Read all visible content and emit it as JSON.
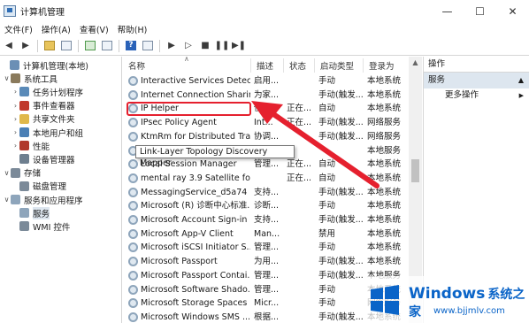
{
  "window": {
    "title": "计算机管理"
  },
  "window_controls": {
    "minimize": "—",
    "maximize": "☐",
    "close": "✕"
  },
  "menu": [
    "文件(F)",
    "操作(A)",
    "查看(V)",
    "帮助(H)"
  ],
  "tree": [
    {
      "label": "计算机管理(本地)",
      "level": 0,
      "arrow": "",
      "icon": "computer-icon",
      "color": "#6b8fb5"
    },
    {
      "label": "系统工具",
      "level": 1,
      "arrow": "∨",
      "icon": "tools-icon",
      "color": "#8a7a5c"
    },
    {
      "label": "任务计划程序",
      "level": 2,
      "arrow": "›",
      "icon": "clock-icon",
      "color": "#5a8ab8"
    },
    {
      "label": "事件查看器",
      "level": 2,
      "arrow": "›",
      "icon": "event-icon",
      "color": "#c0392b"
    },
    {
      "label": "共享文件夹",
      "level": 2,
      "arrow": "›",
      "icon": "folder-icon",
      "color": "#e0b84a"
    },
    {
      "label": "本地用户和组",
      "level": 2,
      "arrow": "›",
      "icon": "users-icon",
      "color": "#4a7fb5"
    },
    {
      "label": "性能",
      "level": 2,
      "arrow": "›",
      "icon": "performance-icon",
      "color": "#b0382c"
    },
    {
      "label": "设备管理器",
      "level": 2,
      "arrow": "",
      "icon": "device-icon",
      "color": "#6e7f8f"
    },
    {
      "label": "存储",
      "level": 1,
      "arrow": "∨",
      "icon": "storage-icon",
      "color": "#7b8a99"
    },
    {
      "label": "磁盘管理",
      "level": 2,
      "arrow": "",
      "icon": "disk-icon",
      "color": "#7b8a99"
    },
    {
      "label": "服务和应用程序",
      "level": 1,
      "arrow": "∨",
      "icon": "services-apps-icon",
      "color": "#8ea5bb"
    },
    {
      "label": "服务",
      "level": 2,
      "arrow": "",
      "icon": "gear-icon",
      "color": "#8ea5bb",
      "selected": true
    },
    {
      "label": "WMI 控件",
      "level": 2,
      "arrow": "",
      "icon": "wmi-icon",
      "color": "#7b8a99"
    }
  ],
  "columns": [
    "名称",
    "描述",
    "状态",
    "启动类型",
    "登录为"
  ],
  "services": [
    {
      "name": "Interactive Services Detect...",
      "desc": "启用...",
      "status": "",
      "startup": "手动",
      "logon": "本地系统"
    },
    {
      "name": "Internet Connection Sharin...",
      "desc": "为家...",
      "status": "",
      "startup": "手动(触发...",
      "logon": "本地系统"
    },
    {
      "name": "IP Helper",
      "desc": "使用...",
      "status": "正在...",
      "startup": "自动",
      "logon": "本地系统"
    },
    {
      "name": "IPsec Policy Agent",
      "desc": "Int...",
      "status": "正在...",
      "startup": "手动(触发...",
      "logon": "网络服务"
    },
    {
      "name": "KtmRm for Distributed Tra...",
      "desc": "协调...",
      "status": "",
      "startup": "手动(触发...",
      "logon": "网络服务"
    },
    {
      "name": "Link-Layer Topology Discovery Mapper",
      "desc": "",
      "status": "",
      "startup": "",
      "logon": "本地服务"
    },
    {
      "name": "Local Session Manager",
      "desc": "管理...",
      "status": "正在...",
      "startup": "自动",
      "logon": "本地系统"
    },
    {
      "name": "mental ray 3.9 Satellite for ...",
      "desc": "",
      "status": "正在...",
      "startup": "自动",
      "logon": "本地系统"
    },
    {
      "name": "MessagingService_d5a74",
      "desc": "支持...",
      "status": "",
      "startup": "手动(触发...",
      "logon": "本地系统"
    },
    {
      "name": "Microsoft (R) 诊断中心标准...",
      "desc": "诊断...",
      "status": "",
      "startup": "手动",
      "logon": "本地系统"
    },
    {
      "name": "Microsoft Account Sign-in ...",
      "desc": "支持...",
      "status": "",
      "startup": "手动(触发...",
      "logon": "本地系统"
    },
    {
      "name": "Microsoft App-V Client",
      "desc": "Man...",
      "status": "",
      "startup": "禁用",
      "logon": "本地系统"
    },
    {
      "name": "Microsoft iSCSI Initiator S...",
      "desc": "管理...",
      "status": "",
      "startup": "手动",
      "logon": "本地系统"
    },
    {
      "name": "Microsoft Passport",
      "desc": "为用...",
      "status": "",
      "startup": "手动(触发...",
      "logon": "本地系统"
    },
    {
      "name": "Microsoft Passport Contai...",
      "desc": "管理...",
      "status": "",
      "startup": "手动(触发...",
      "logon": "本地服务"
    },
    {
      "name": "Microsoft Software Shado...",
      "desc": "管理...",
      "status": "",
      "startup": "手动",
      "logon": "本地系统"
    },
    {
      "name": "Microsoft Storage Spaces ...",
      "desc": "Micr...",
      "status": "",
      "startup": "手动",
      "logon": "网络服务"
    },
    {
      "name": "Microsoft Windows SMS ...",
      "desc": "根据...",
      "status": "",
      "startup": "手动(触发...",
      "logon": "本地系统"
    }
  ],
  "tooltip": "Link-Layer Topology Discovery Mapper",
  "actions": {
    "header": "操作",
    "section": "服务",
    "items": [
      "更多操作"
    ]
  },
  "watermark": {
    "brand": "Windows",
    "brand_cn": "系统之家",
    "url": "www.bjjmlv.com"
  },
  "colors": {
    "highlight": "#e5202e",
    "selection": "#dde6ef",
    "watermark": "#0a64c8"
  }
}
